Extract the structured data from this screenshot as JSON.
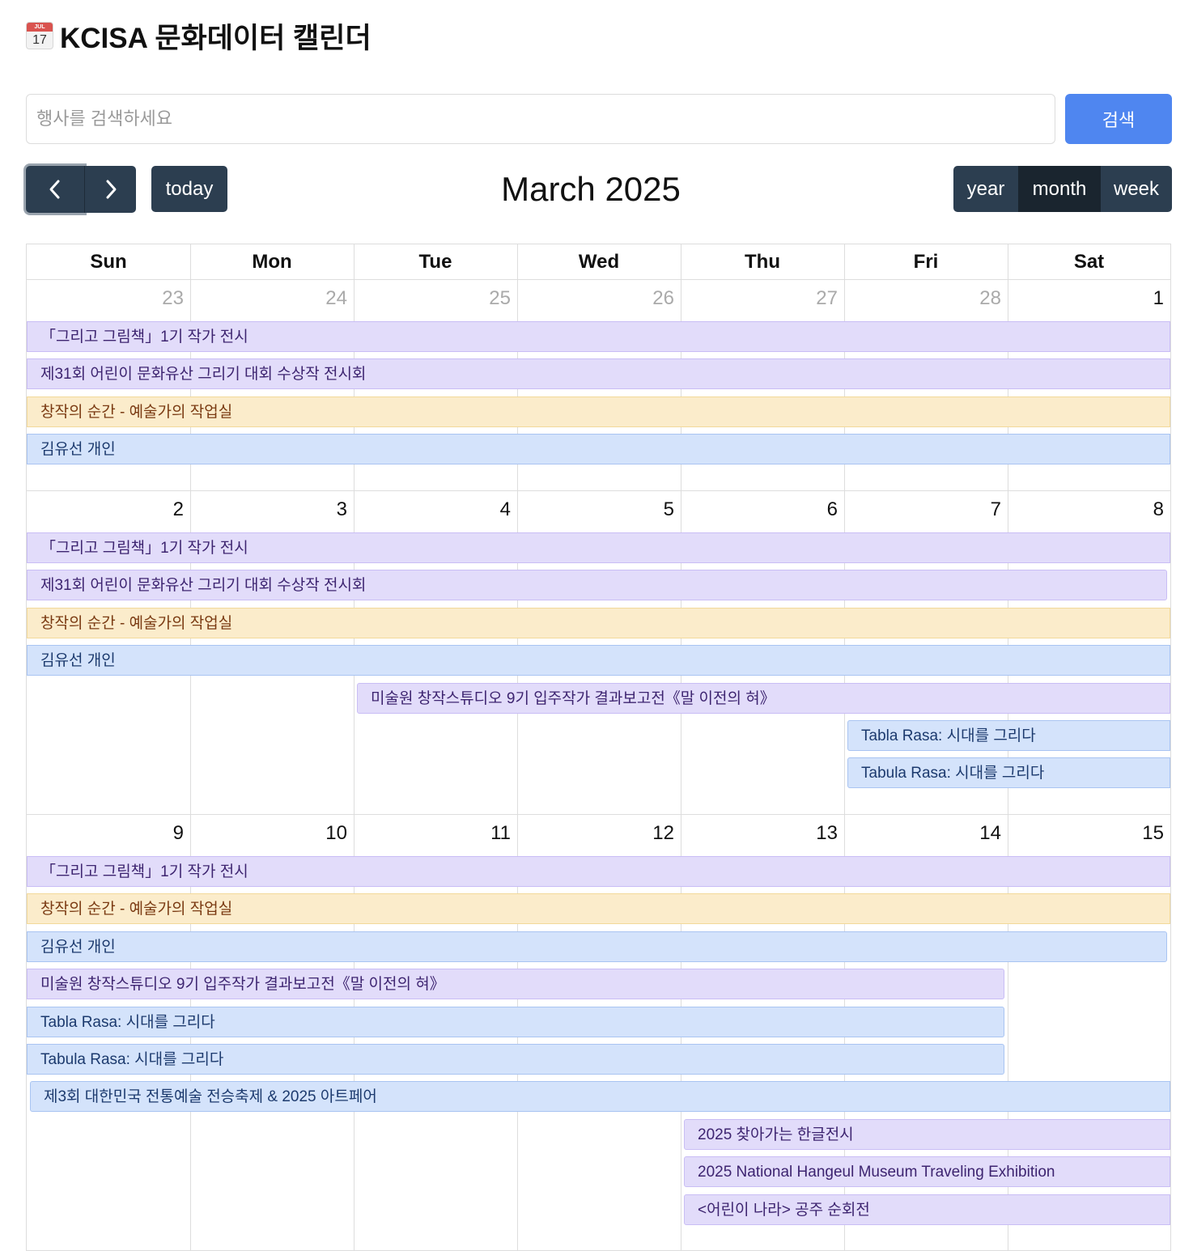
{
  "header": {
    "icon_top": "JUL",
    "icon_day": "17",
    "title": "KCISA 문화데이터 캘린더"
  },
  "search": {
    "placeholder": "행사를 검색하세요",
    "value": "",
    "button_label": "검색"
  },
  "toolbar": {
    "today_label": "today",
    "month_title": "March 2025",
    "views": [
      "year",
      "month",
      "week"
    ],
    "active_view": "month"
  },
  "weekdays": [
    "Sun",
    "Mon",
    "Tue",
    "Wed",
    "Thu",
    "Fri",
    "Sat"
  ],
  "weeks": [
    {
      "days": [
        {
          "num": "23",
          "other": true
        },
        {
          "num": "24",
          "other": true
        },
        {
          "num": "25",
          "other": true
        },
        {
          "num": "26",
          "other": true
        },
        {
          "num": "27",
          "other": true
        },
        {
          "num": "28",
          "other": true
        },
        {
          "num": "1",
          "other": false
        }
      ],
      "events": [
        {
          "title": "「그리고 그림책」1기 작가 전시",
          "color": "purple",
          "start": 0,
          "end": 6,
          "cont_left": true,
          "cont_right": true
        },
        {
          "title": "제31회 어린이 문화유산 그리기 대회 수상작 전시회",
          "color": "purple",
          "start": 0,
          "end": 6,
          "cont_left": true,
          "cont_right": true
        },
        {
          "title": "창작의 순간 - 예술가의 작업실",
          "color": "orange",
          "start": 0,
          "end": 6,
          "cont_left": true,
          "cont_right": true
        },
        {
          "title": "김유선 개인",
          "color": "blue",
          "start": 0,
          "end": 6,
          "cont_left": true,
          "cont_right": true
        }
      ]
    },
    {
      "days": [
        {
          "num": "2",
          "other": false
        },
        {
          "num": "3",
          "other": false
        },
        {
          "num": "4",
          "other": false
        },
        {
          "num": "5",
          "other": false
        },
        {
          "num": "6",
          "other": false
        },
        {
          "num": "7",
          "other": false
        },
        {
          "num": "8",
          "other": false
        }
      ],
      "events": [
        {
          "title": "「그리고 그림책」1기 작가 전시",
          "color": "purple",
          "start": 0,
          "end": 6,
          "cont_left": true,
          "cont_right": true
        },
        {
          "title": "제31회 어린이 문화유산 그리기 대회 수상작 전시회",
          "color": "purple",
          "start": 0,
          "end": 6,
          "cont_left": true,
          "cont_right": false
        },
        {
          "title": "창작의 순간 - 예술가의 작업실",
          "color": "orange",
          "start": 0,
          "end": 6,
          "cont_left": true,
          "cont_right": true
        },
        {
          "title": "김유선 개인",
          "color": "blue",
          "start": 0,
          "end": 6,
          "cont_left": true,
          "cont_right": true
        },
        {
          "title": "미술원 창작스튜디오 9기 입주작가 결과보고전《말 이전의 혀》",
          "color": "purple",
          "start": 2,
          "end": 6,
          "cont_left": false,
          "cont_right": true
        },
        {
          "title": "Tabla Rasa: 시대를 그리다",
          "color": "blue",
          "start": 5,
          "end": 6,
          "cont_left": false,
          "cont_right": true
        },
        {
          "title": "Tabula Rasa: 시대를 그리다",
          "color": "blue",
          "start": 5,
          "end": 6,
          "cont_left": false,
          "cont_right": true
        }
      ]
    },
    {
      "days": [
        {
          "num": "9",
          "other": false
        },
        {
          "num": "10",
          "other": false
        },
        {
          "num": "11",
          "other": false
        },
        {
          "num": "12",
          "other": false
        },
        {
          "num": "13",
          "other": false
        },
        {
          "num": "14",
          "other": false
        },
        {
          "num": "15",
          "other": false
        }
      ],
      "events": [
        {
          "title": "「그리고 그림책」1기 작가 전시",
          "color": "purple",
          "start": 0,
          "end": 6,
          "cont_left": true,
          "cont_right": true
        },
        {
          "title": "창작의 순간 - 예술가의 작업실",
          "color": "orange",
          "start": 0,
          "end": 6,
          "cont_left": true,
          "cont_right": true
        },
        {
          "title": "김유선 개인",
          "color": "blue",
          "start": 0,
          "end": 6,
          "cont_left": true,
          "cont_right": false
        },
        {
          "title": "미술원 창작스튜디오 9기 입주작가 결과보고전《말 이전의 혀》",
          "color": "purple",
          "start": 0,
          "end": 5,
          "cont_left": true,
          "cont_right": false
        },
        {
          "title": "Tabla Rasa: 시대를 그리다",
          "color": "blue",
          "start": 0,
          "end": 5,
          "cont_left": true,
          "cont_right": false
        },
        {
          "title": "Tabula Rasa: 시대를 그리다",
          "color": "blue",
          "start": 0,
          "end": 5,
          "cont_left": true,
          "cont_right": false
        },
        {
          "title": "제3회 대한민국 전통예술 전승축제 & 2025 아트페어",
          "color": "blue",
          "start": 0,
          "end": 6,
          "cont_left": false,
          "cont_right": true
        },
        {
          "title": "2025 찾아가는 한글전시",
          "color": "purple",
          "start": 4,
          "end": 6,
          "cont_left": false,
          "cont_right": true
        },
        {
          "title": "2025 National Hangeul Museum Traveling Exhibition",
          "color": "purple",
          "start": 4,
          "end": 6,
          "cont_left": false,
          "cont_right": true
        },
        {
          "title": "<어린이 나라> 공주 순회전",
          "color": "purple",
          "start": 4,
          "end": 6,
          "cont_left": false,
          "cont_right": true
        }
      ]
    }
  ]
}
